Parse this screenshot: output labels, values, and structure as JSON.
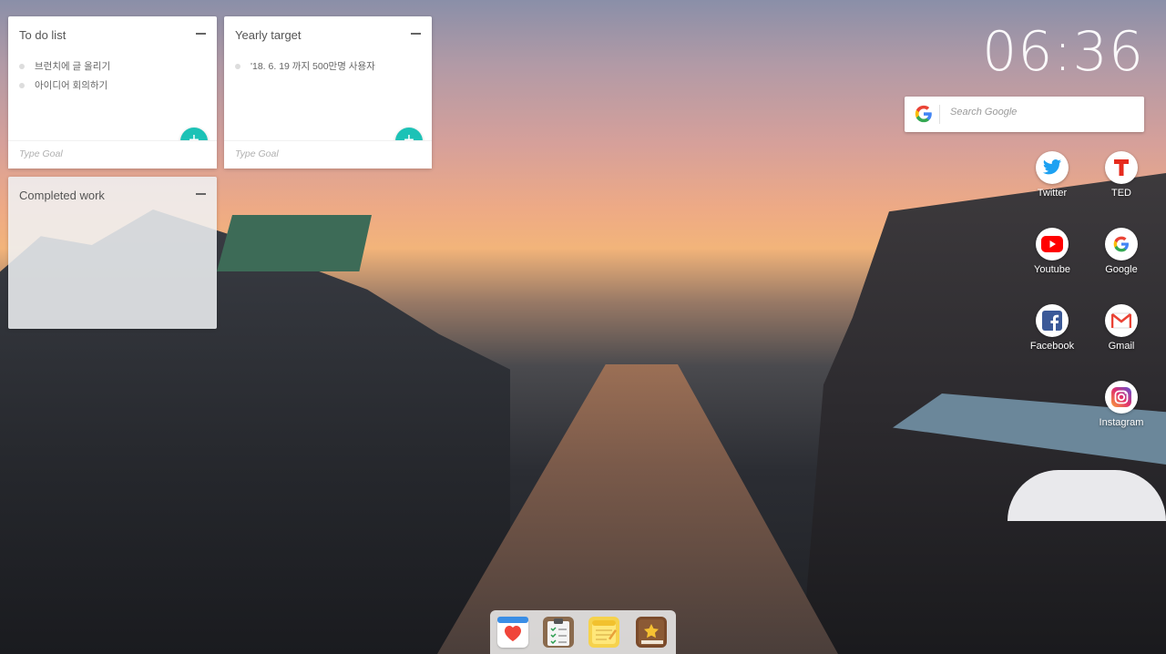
{
  "todo": {
    "title": "To do list",
    "items": [
      "브런치에 글 올리기",
      "아이디어 회의하기"
    ],
    "input_placeholder": "Type Goal",
    "add_label": "+"
  },
  "yearly": {
    "title": "Yearly target",
    "items": [
      "'18. 6. 19 까지 500만명 사용자"
    ],
    "input_placeholder": "Type Goal",
    "add_label": "+"
  },
  "completed": {
    "title": "Completed work"
  },
  "clock": {
    "time": "06:36"
  },
  "search": {
    "placeholder": "Search Google"
  },
  "shortcuts": [
    {
      "label": "Twitter",
      "icon": "twitter-icon"
    },
    {
      "label": "TED",
      "icon": "ted-icon"
    },
    {
      "label": "Youtube",
      "icon": "youtube-icon"
    },
    {
      "label": "Google",
      "icon": "google-icon"
    },
    {
      "label": "Facebook",
      "icon": "facebook-icon"
    },
    {
      "label": "Gmail",
      "icon": "gmail-icon"
    },
    {
      "label": "Instagram",
      "icon": "instagram-icon"
    }
  ],
  "dock": [
    {
      "icon": "health-heart-icon"
    },
    {
      "icon": "clipboard-checklist-icon"
    },
    {
      "icon": "notes-icon"
    },
    {
      "icon": "bookmark-star-book-icon"
    }
  ],
  "colors": {
    "accent": "#1cc2b6",
    "twitter": "#1da1f2",
    "ted": "#e62b1e",
    "youtube": "#ff0000",
    "facebook": "#3b5998"
  }
}
